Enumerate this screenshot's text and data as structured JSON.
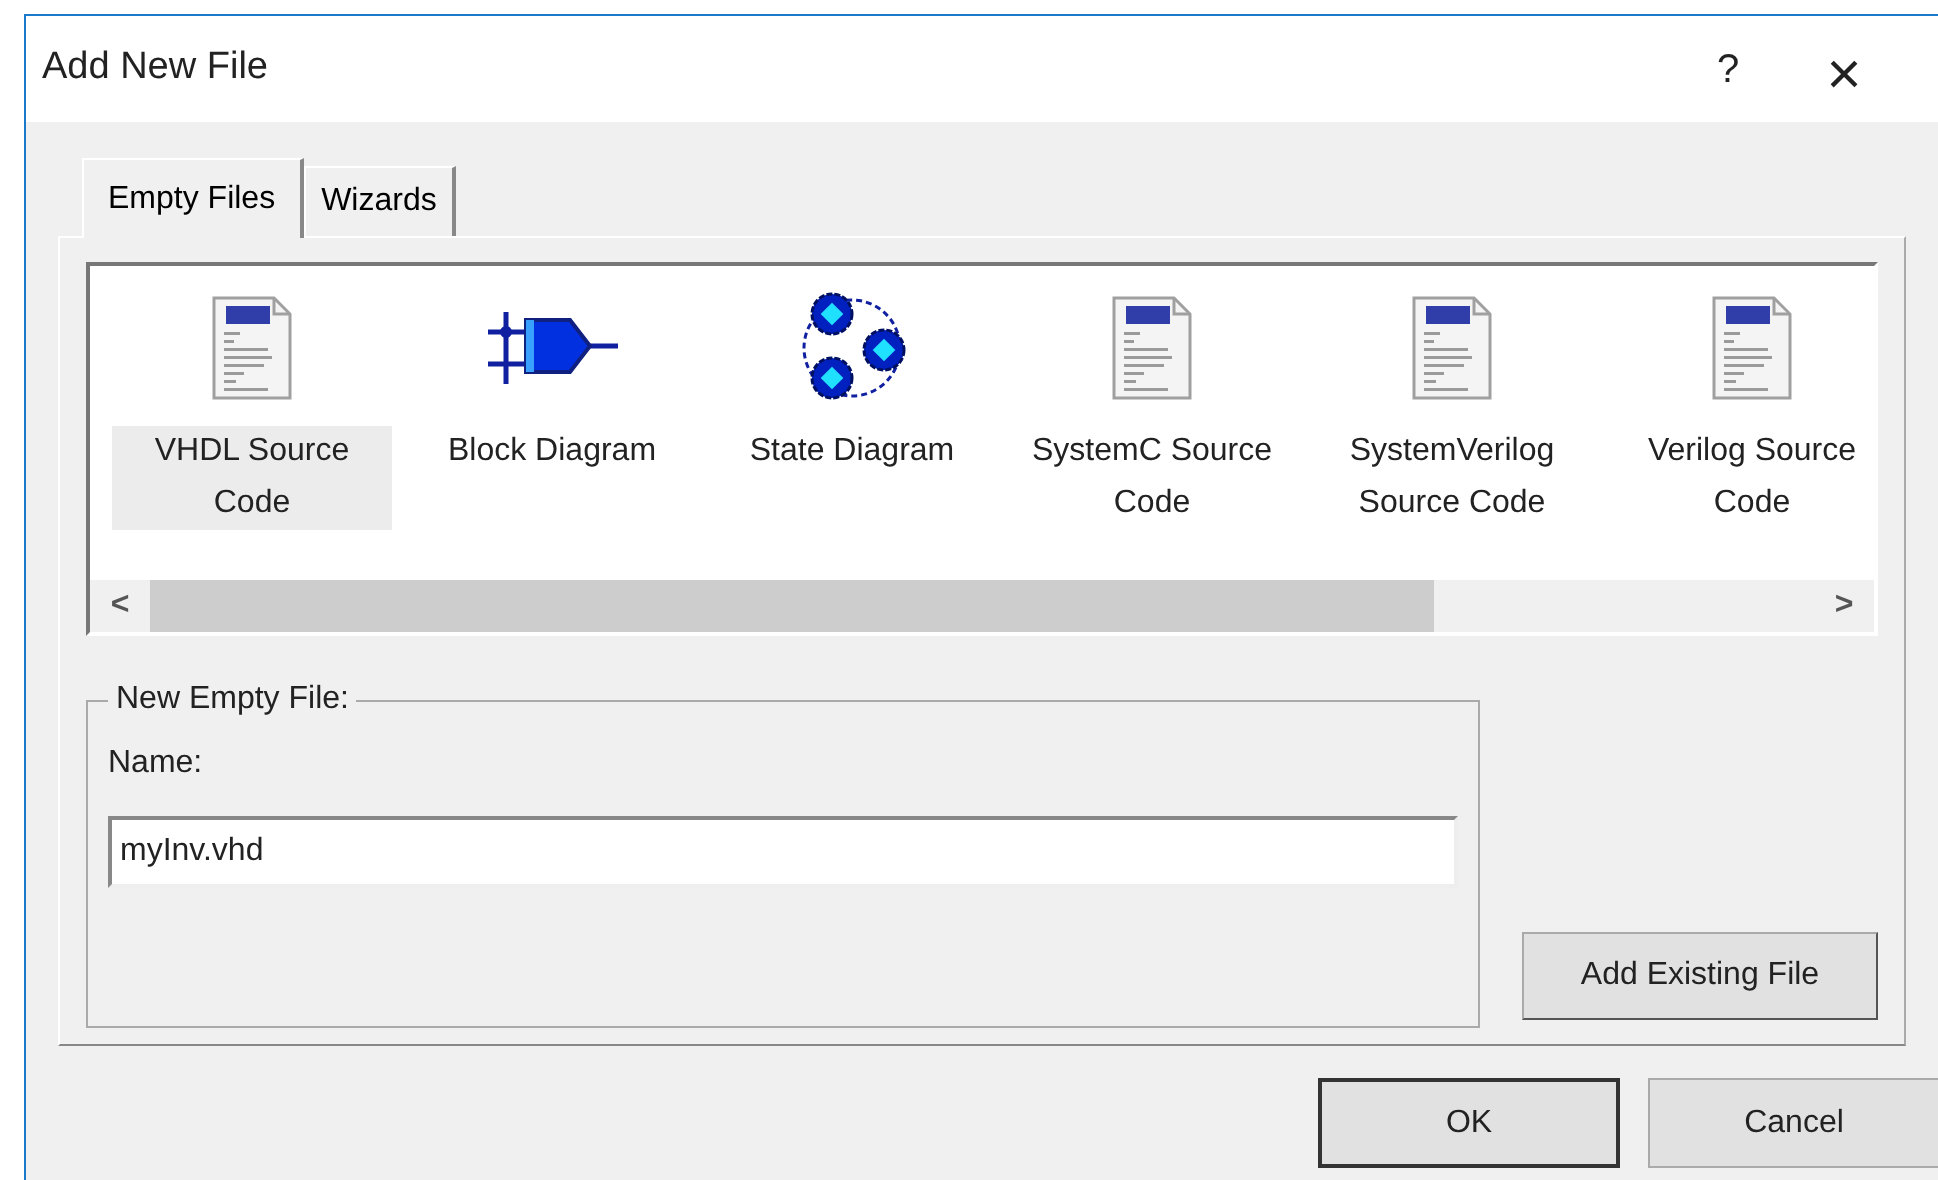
{
  "window": {
    "title": "Add New File",
    "help": "?",
    "close": "×"
  },
  "tabs": [
    {
      "label": "Empty Files",
      "selected": true
    },
    {
      "label": "Wizards",
      "selected": false
    }
  ],
  "file_types": [
    {
      "kind": "hdl",
      "label": "VHDL Source Code",
      "selected": true
    },
    {
      "kind": "block",
      "label": "Block Diagram",
      "selected": false
    },
    {
      "kind": "state",
      "label": "State Diagram",
      "selected": false
    },
    {
      "kind": "hdl",
      "label": "SystemC Source Code",
      "selected": false
    },
    {
      "kind": "hdl",
      "label": "SystemVerilog Source Code",
      "selected": false
    },
    {
      "kind": "hdl",
      "label": "Verilog Source Code",
      "selected": false
    }
  ],
  "scroll_left": "<",
  "scroll_right": ">",
  "new_empty_file": {
    "title": "New Empty File:",
    "name_label": "Name:",
    "name_value": "myInv.vhd"
  },
  "buttons": {
    "add_existing": "Add Existing File",
    "ok": "OK",
    "cancel": "Cancel"
  }
}
